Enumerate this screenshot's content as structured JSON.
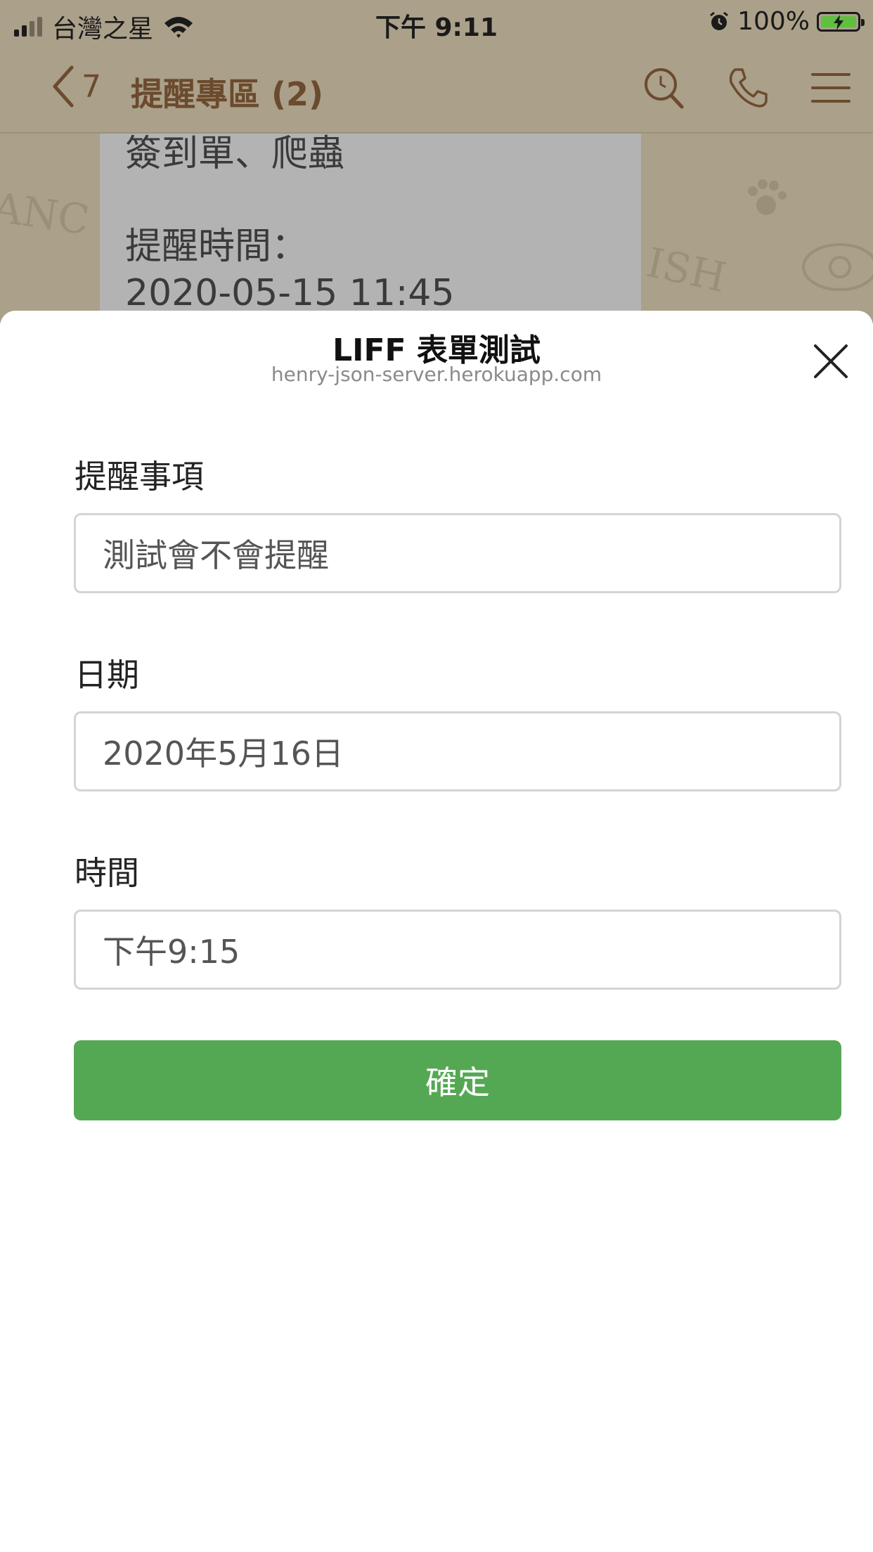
{
  "status_bar": {
    "carrier": "台灣之星",
    "time": "下午 9:11",
    "battery_percent": "100%",
    "battery_level": 1.0,
    "icons": [
      "signal-icon",
      "wifi-icon",
      "alarm-icon",
      "battery-charging-icon"
    ]
  },
  "chat_header": {
    "back_count": "7",
    "title": "提醒專區 (2)",
    "icons": [
      "back-chevron-icon",
      "search-icon",
      "phone-icon",
      "menu-icon"
    ]
  },
  "chat_message": {
    "line1": "簽到單、爬蟲",
    "line2": "提醒時間：",
    "line3": "2020-05-15 11:45"
  },
  "sheet": {
    "title": "LIFF 表單測試",
    "subtitle": "henry-json-server.herokuapp.com",
    "close_icon": "close-icon"
  },
  "form": {
    "item_label": "提醒事項",
    "item_value": "測試會不會提醒",
    "date_label": "日期",
    "date_value": "2020年5月16日",
    "time_label": "時間",
    "time_value": "下午9:15",
    "submit_label": "確定"
  },
  "colors": {
    "header_bg": "#aba089",
    "header_text": "#6b4a2e",
    "submit_bg": "#55a853",
    "bubble_bg": "#b3b3b3"
  }
}
